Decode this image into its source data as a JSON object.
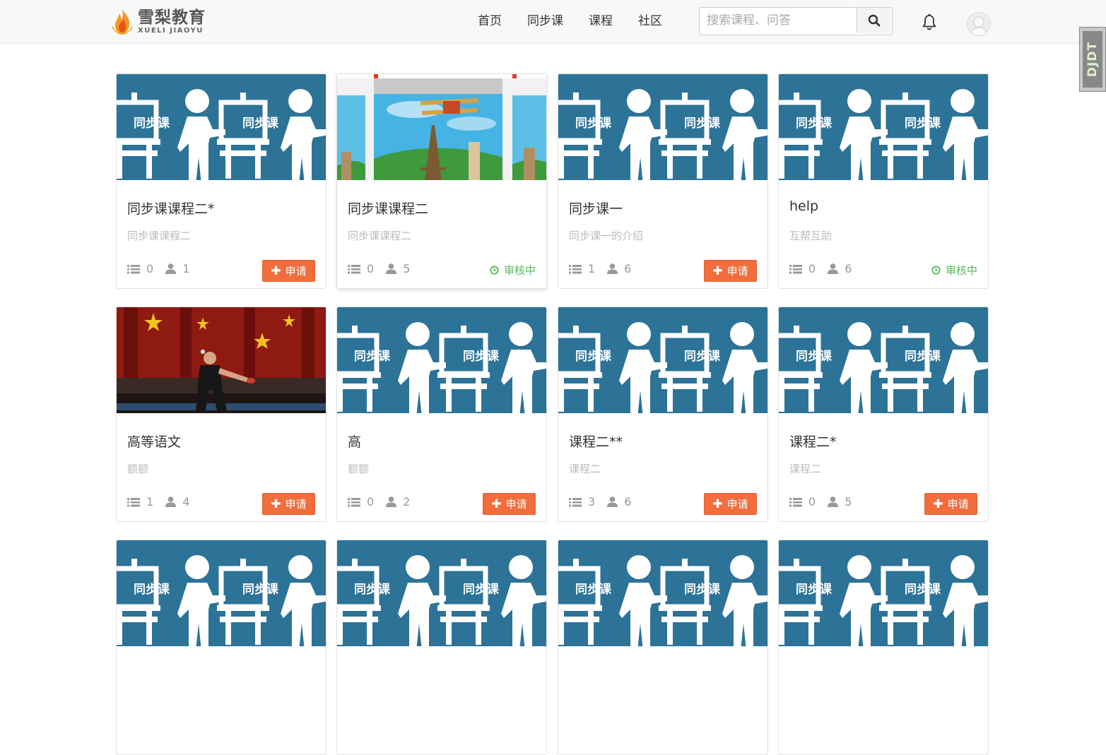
{
  "brand": {
    "name_cn": "雪梨教育",
    "name_en": "XUELI JIAOYU"
  },
  "nav": {
    "items": [
      "首页",
      "同步课",
      "课程",
      "社区"
    ]
  },
  "search": {
    "placeholder": "搜索课程、问答"
  },
  "side_widget": {
    "label": "DJDT"
  },
  "cover_text": "同步课",
  "colors": {
    "accent": "#f26d3d",
    "cover_blue": "#2c7397",
    "status_green": "#5cb85c"
  },
  "courses": [
    {
      "title": "同步课课程二*",
      "desc": "同步课课程二",
      "lessons": "0",
      "students": "1",
      "action": "申请",
      "cover": "sync"
    },
    {
      "title": "同步课课程二",
      "desc": "同步课课程二",
      "lessons": "0",
      "students": "5",
      "action": "审核中",
      "cover": "plane"
    },
    {
      "title": "同步课一",
      "desc": "同步课一的介绍",
      "lessons": "1",
      "students": "6",
      "action": "申请",
      "cover": "sync"
    },
    {
      "title": "help",
      "desc": "互帮互助",
      "lessons": "0",
      "students": "6",
      "action": "审核中",
      "cover": "sync"
    },
    {
      "title": "高等语文",
      "desc": "额额",
      "lessons": "1",
      "students": "4",
      "action": "申请",
      "cover": "pingpong"
    },
    {
      "title": "高",
      "desc": "额额",
      "lessons": "0",
      "students": "2",
      "action": "申请",
      "cover": "sync"
    },
    {
      "title": "课程二**",
      "desc": "课程二",
      "lessons": "3",
      "students": "6",
      "action": "申请",
      "cover": "sync"
    },
    {
      "title": "课程二*",
      "desc": "课程二",
      "lessons": "0",
      "students": "5",
      "action": "申请",
      "cover": "sync"
    },
    {
      "title": "",
      "desc": "",
      "lessons": "",
      "students": "",
      "action": "",
      "cover": "sync"
    },
    {
      "title": "",
      "desc": "",
      "lessons": "",
      "students": "",
      "action": "",
      "cover": "sync"
    },
    {
      "title": "",
      "desc": "",
      "lessons": "",
      "students": "",
      "action": "",
      "cover": "sync"
    },
    {
      "title": "",
      "desc": "",
      "lessons": "",
      "students": "",
      "action": "",
      "cover": "sync"
    }
  ]
}
